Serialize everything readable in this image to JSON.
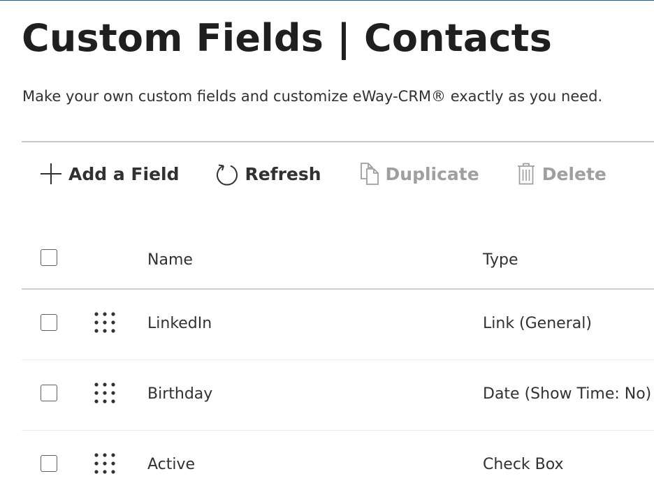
{
  "header": {
    "title": "Custom Fields | Contacts",
    "subtitle": "Make your own custom fields and customize eWay-CRM® exactly as you need."
  },
  "toolbar": {
    "add_label": "Add a Field",
    "refresh_label": "Refresh",
    "duplicate_label": "Duplicate",
    "delete_label": "Delete",
    "icons": [
      "plus-icon",
      "refresh-icon",
      "duplicate-icon",
      "trash-icon"
    ],
    "disabled_color": "#a19f9d"
  },
  "table": {
    "columns": [
      "Name",
      "Type"
    ],
    "rows": [
      {
        "name": "LinkedIn",
        "type": "Link (General)",
        "checked": false
      },
      {
        "name": "Birthday",
        "type": "Date (Show Time: No)",
        "checked": false
      },
      {
        "name": "Active",
        "type": "Check Box",
        "checked": false
      }
    ]
  },
  "colors": {
    "accent": "#1a5e8a",
    "text": "#323130",
    "divider": "#c8c6c4"
  }
}
